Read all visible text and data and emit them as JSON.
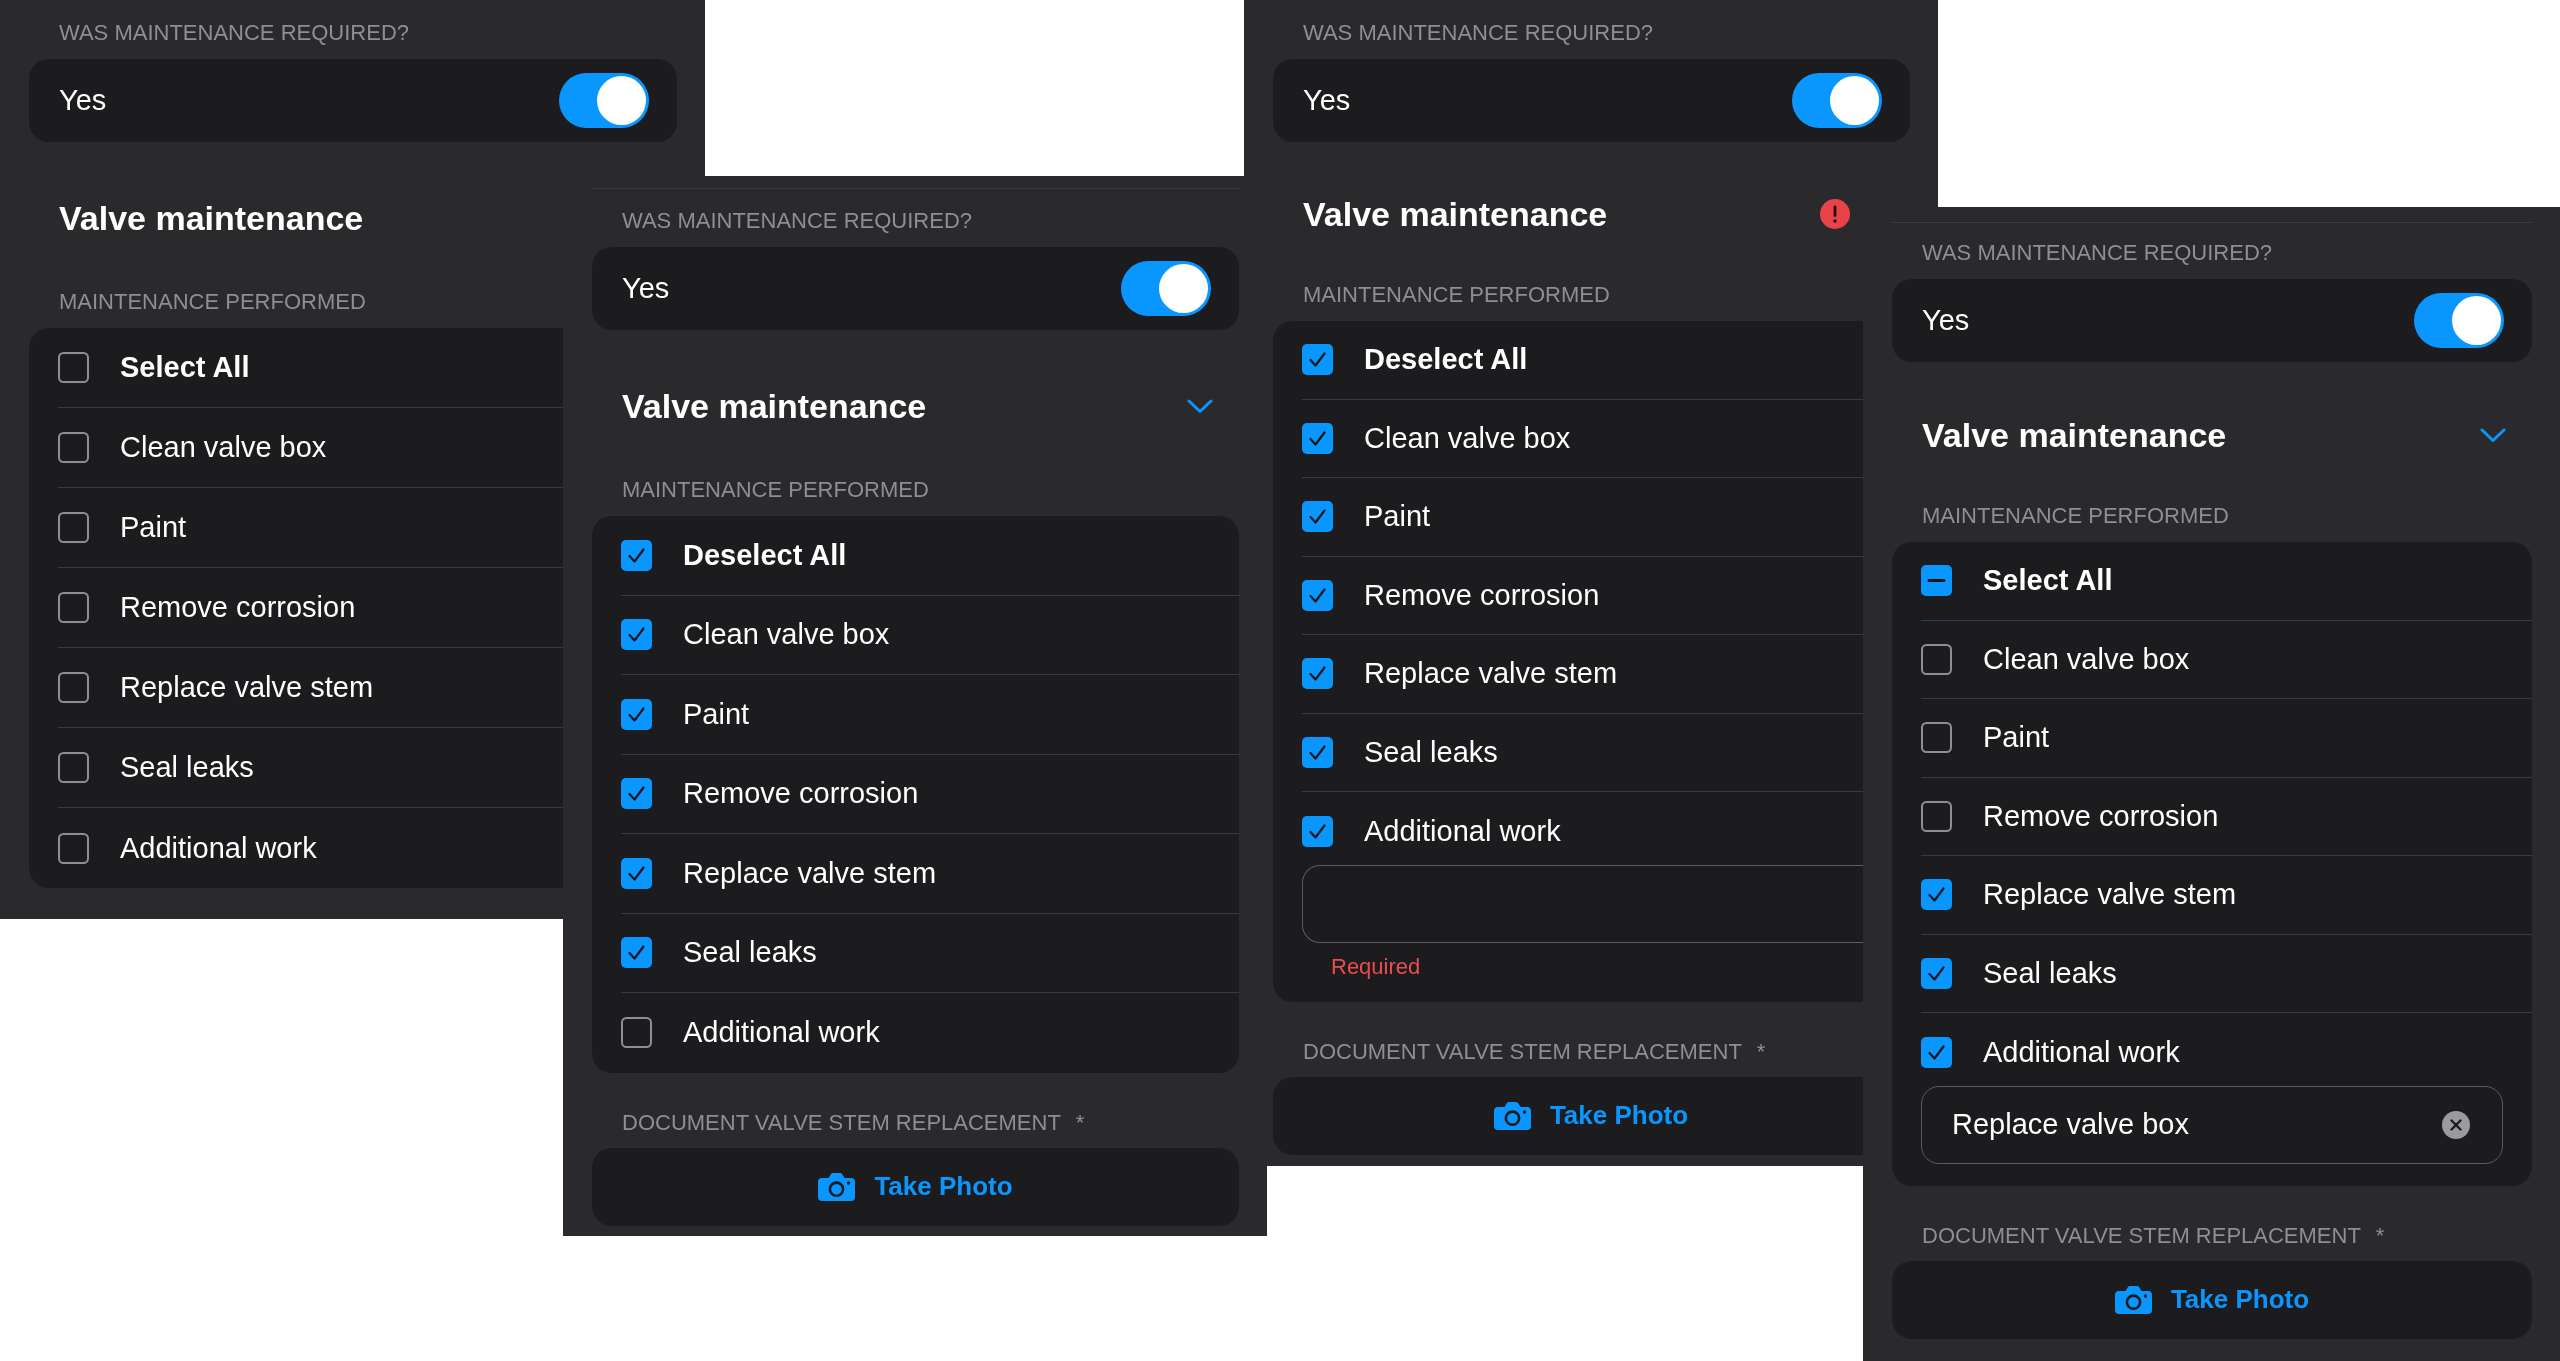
{
  "screens": [
    {
      "toggle": {
        "label": "WAS MAINTENANCE REQUIRED?",
        "text": "Yes",
        "on": true
      },
      "section": {
        "title": "Valve maintenance",
        "chevron": false,
        "alert": false
      },
      "checklist": {
        "label": "MAINTENANCE PERFORMED",
        "items": [
          {
            "kind": "select_all",
            "label": "Select All",
            "checked": false,
            "indeterminate": false
          },
          {
            "kind": "option",
            "label": "Clean valve box",
            "checked": false
          },
          {
            "kind": "option",
            "label": "Paint",
            "checked": false
          },
          {
            "kind": "option",
            "label": "Remove corrosion",
            "checked": false
          },
          {
            "kind": "option",
            "label": "Replace valve stem",
            "checked": false
          },
          {
            "kind": "option",
            "label": "Seal leaks",
            "checked": false
          },
          {
            "kind": "option",
            "label": "Additional work",
            "checked": false
          }
        ]
      }
    },
    {
      "toggle": {
        "label": "WAS MAINTENANCE REQUIRED?",
        "text": "Yes",
        "on": true
      },
      "section": {
        "title": "Valve maintenance",
        "chevron": true,
        "alert": false
      },
      "checklist": {
        "label": "MAINTENANCE PERFORMED",
        "items": [
          {
            "kind": "select_all",
            "label": "Deselect All",
            "checked": true,
            "indeterminate": false
          },
          {
            "kind": "option",
            "label": "Clean valve box",
            "checked": true
          },
          {
            "kind": "option",
            "label": "Paint",
            "checked": true
          },
          {
            "kind": "option",
            "label": "Remove corrosion",
            "checked": true
          },
          {
            "kind": "option",
            "label": "Replace valve stem",
            "checked": true
          },
          {
            "kind": "option",
            "label": "Seal leaks",
            "checked": true
          },
          {
            "kind": "option",
            "label": "Additional work",
            "checked": false
          }
        ]
      },
      "photo": {
        "label": "DOCUMENT VALVE STEM REPLACEMENT",
        "mark": "*",
        "button": "Take Photo"
      }
    },
    {
      "toggle": {
        "label": "WAS MAINTENANCE REQUIRED?",
        "text": "Yes",
        "on": true
      },
      "section": {
        "title": "Valve maintenance",
        "chevron": false,
        "alert": true
      },
      "checklist": {
        "label": "MAINTENANCE PERFORMED",
        "items": [
          {
            "kind": "select_all",
            "label": "Deselect All",
            "checked": true,
            "indeterminate": false
          },
          {
            "kind": "option",
            "label": "Clean valve box",
            "checked": true
          },
          {
            "kind": "option",
            "label": "Paint",
            "checked": true
          },
          {
            "kind": "option",
            "label": "Remove corrosion",
            "checked": true
          },
          {
            "kind": "option",
            "label": "Replace valve stem",
            "checked": true
          },
          {
            "kind": "option",
            "label": "Seal leaks",
            "checked": true
          },
          {
            "kind": "option",
            "label": "Additional work",
            "checked": true
          }
        ],
        "note_field": {
          "error": "Required"
        }
      },
      "photo": {
        "label": "DOCUMENT VALVE STEM REPLACEMENT",
        "mark": "*",
        "button": "Take Photo"
      }
    },
    {
      "toggle": {
        "label": "WAS MAINTENANCE REQUIRED?",
        "text": "Yes",
        "on": true
      },
      "section": {
        "title": "Valve maintenance",
        "chevron": true,
        "alert": false
      },
      "checklist": {
        "label": "MAINTENANCE PERFORMED",
        "items": [
          {
            "kind": "select_all",
            "label": "Select All",
            "indeterminate": true
          },
          {
            "kind": "option",
            "label": "Clean valve box",
            "checked": false
          },
          {
            "kind": "option",
            "label": "Paint",
            "checked": false
          },
          {
            "kind": "option",
            "label": "Remove corrosion",
            "checked": false
          },
          {
            "kind": "option",
            "label": "Replace valve stem",
            "checked": true
          },
          {
            "kind": "option",
            "label": "Seal leaks",
            "checked": true
          },
          {
            "kind": "option",
            "label": "Additional work",
            "checked": true
          }
        ],
        "note_field": {
          "value": "Replace valve box"
        }
      },
      "photo": {
        "label": "DOCUMENT VALVE STEM REPLACEMENT",
        "mark": "*",
        "button": "Take Photo"
      }
    }
  ]
}
